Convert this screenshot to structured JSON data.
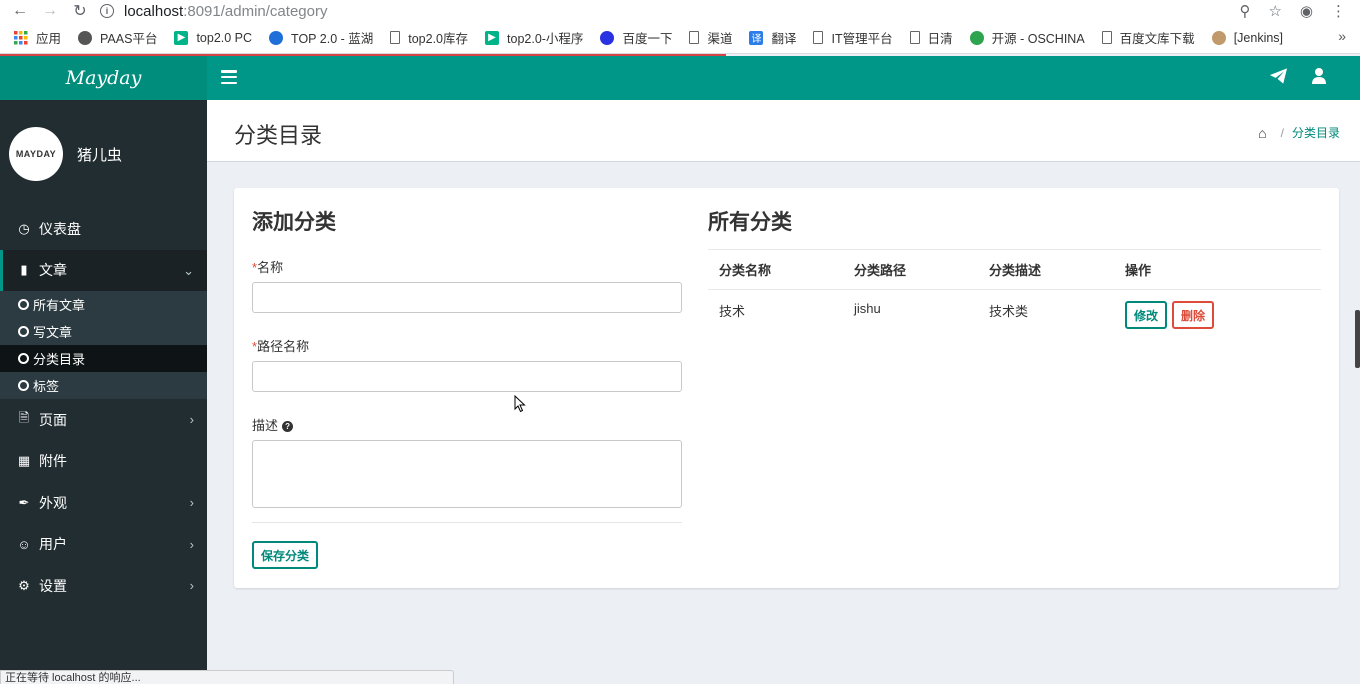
{
  "browser": {
    "url_host": "localhost",
    "url_path": ":8091/admin/category",
    "icons": [
      "back-icon",
      "forward-icon",
      "reload-icon",
      "zoom-icon",
      "star-icon",
      "account-icon",
      "menu-icon"
    ],
    "bookmarks": [
      {
        "label": "应用",
        "icon": "apps-icon",
        "color": "#4285f4"
      },
      {
        "label": "PAAS平台",
        "icon": "paas-icon",
        "color": "#555555"
      },
      {
        "label": "top2.0 PC",
        "icon": "play-icon",
        "color": "#00b388"
      },
      {
        "label": "TOP 2.0 - 蓝湖",
        "icon": "lanhu-icon",
        "color": "#1e6fd9"
      },
      {
        "label": "top2.0库存",
        "icon": "doc-icon",
        "color": ""
      },
      {
        "label": "top2.0-小程序",
        "icon": "play-icon",
        "color": "#00b388"
      },
      {
        "label": "百度一下",
        "icon": "baidu-icon",
        "color": "#2932e1"
      },
      {
        "label": "渠道",
        "icon": "doc-icon",
        "color": ""
      },
      {
        "label": "翻译",
        "icon": "translate-icon",
        "color": "#2b7de9"
      },
      {
        "label": "IT管理平台",
        "icon": "doc-icon",
        "color": ""
      },
      {
        "label": "日清",
        "icon": "doc-icon",
        "color": ""
      },
      {
        "label": "开源 - OSCHINA",
        "icon": "oschina-icon",
        "color": "#2ea44f"
      },
      {
        "label": "百度文库下载",
        "icon": "doc-icon",
        "color": ""
      },
      {
        "label": "[Jenkins]",
        "icon": "jenkins-icon",
        "color": "#c19a6b"
      }
    ],
    "more_label": "»",
    "status_text": "正在等待 localhost 的响应..."
  },
  "app": {
    "logo": "Mayday",
    "accent_color": "#009688",
    "user_name": "猪儿虫",
    "avatar_text": "MAYDAY"
  },
  "sidebar": {
    "items": [
      {
        "label": "仪表盘",
        "icon": "dashboard-icon"
      },
      {
        "label": "文章",
        "icon": "book-icon",
        "expanded": true
      },
      {
        "label": "页面",
        "icon": "file-icon"
      },
      {
        "label": "附件",
        "icon": "image-icon"
      },
      {
        "label": "外观",
        "icon": "brush-icon"
      },
      {
        "label": "用户",
        "icon": "user-circle-icon"
      },
      {
        "label": "设置",
        "icon": "gear-icon"
      }
    ],
    "sub_items": [
      {
        "label": "所有文章"
      },
      {
        "label": "写文章"
      },
      {
        "label": "分类目录",
        "active": true
      },
      {
        "label": "标签"
      }
    ]
  },
  "header": {
    "title": "分类目录",
    "breadcrumb_sep": "/",
    "breadcrumb_current": "分类目录"
  },
  "form": {
    "title": "添加分类",
    "name_label": "名称",
    "path_label": "路径名称",
    "desc_label": "描述",
    "required_mark": "*",
    "help_glyph": "?",
    "name_value": "",
    "path_value": "",
    "desc_value": "",
    "save_label": "保存分类"
  },
  "table": {
    "title": "所有分类",
    "columns": [
      "分类名称",
      "分类路径",
      "分类描述",
      "操作"
    ],
    "rows": [
      {
        "name": "技术",
        "path": "jishu",
        "desc": "技术类",
        "edit_label": "修改",
        "delete_label": "删除"
      }
    ]
  }
}
